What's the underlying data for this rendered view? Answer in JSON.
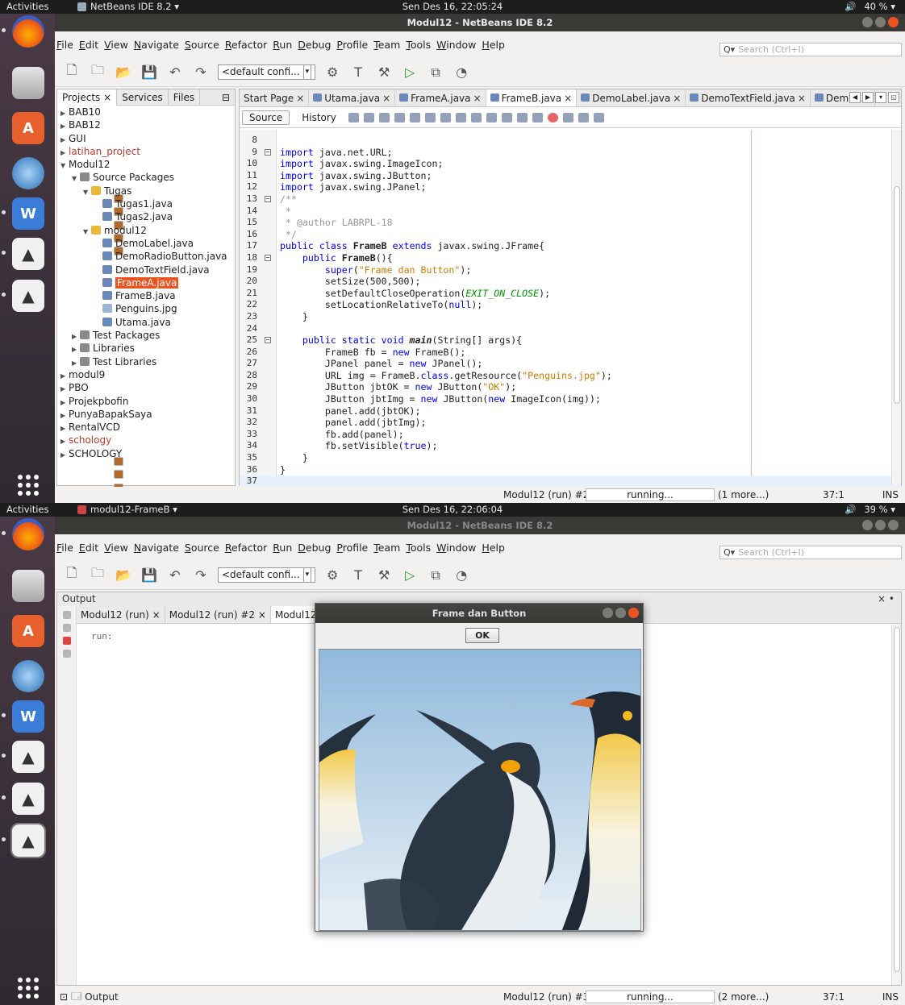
{
  "screen1": {
    "topbar": {
      "activities": "Activities",
      "app": "NetBeans IDE 8.2 ▾",
      "clock": "Sen Des 16, 22:05:24",
      "volume": "🔊",
      "battery": "40 % ▾"
    },
    "window_title": "Modul12 - NetBeans IDE 8.2",
    "menu": [
      "File",
      "Edit",
      "View",
      "Navigate",
      "Source",
      "Refactor",
      "Run",
      "Debug",
      "Profile",
      "Team",
      "Tools",
      "Window",
      "Help"
    ],
    "search_placeholder": "Search (Ctrl+I)",
    "config": "<default confi...",
    "project_tabs": [
      "Projects",
      "Services",
      "Files"
    ],
    "tree": [
      {
        "label": "BAB10",
        "level": 0,
        "type": "proj",
        "tw": "▶"
      },
      {
        "label": "BAB12",
        "level": 0,
        "type": "proj",
        "tw": "▶"
      },
      {
        "label": "GUI",
        "level": 0,
        "type": "proj",
        "tw": "▶"
      },
      {
        "label": "latihan_project",
        "level": 0,
        "type": "proj",
        "tw": "▶",
        "red": true
      },
      {
        "label": "Modul12",
        "level": 0,
        "type": "proj",
        "tw": "▼"
      },
      {
        "label": "Source Packages",
        "level": 1,
        "type": "lib",
        "tw": "▼"
      },
      {
        "label": "Tugas",
        "level": 2,
        "type": "pkg",
        "tw": "▼"
      },
      {
        "label": "Tugas1.java",
        "level": 3,
        "type": "java",
        "tw": ""
      },
      {
        "label": "Tugas2.java",
        "level": 3,
        "type": "java",
        "tw": ""
      },
      {
        "label": "modul12",
        "level": 2,
        "type": "pkg",
        "tw": "▼"
      },
      {
        "label": "DemoLabel.java",
        "level": 3,
        "type": "java",
        "tw": ""
      },
      {
        "label": "DemoRadioButton.java",
        "level": 3,
        "type": "java",
        "tw": ""
      },
      {
        "label": "DemoTextField.java",
        "level": 3,
        "type": "java",
        "tw": ""
      },
      {
        "label": "FrameA.java",
        "level": 3,
        "type": "java",
        "tw": "",
        "sel": true
      },
      {
        "label": "FrameB.java",
        "level": 3,
        "type": "java",
        "tw": ""
      },
      {
        "label": "Penguins.jpg",
        "level": 3,
        "type": "img",
        "tw": ""
      },
      {
        "label": "Utama.java",
        "level": 3,
        "type": "java",
        "tw": ""
      },
      {
        "label": "Test Packages",
        "level": 1,
        "type": "lib",
        "tw": "▶"
      },
      {
        "label": "Libraries",
        "level": 1,
        "type": "lib",
        "tw": "▶"
      },
      {
        "label": "Test Libraries",
        "level": 1,
        "type": "lib",
        "tw": "▶"
      },
      {
        "label": "modul9",
        "level": 0,
        "type": "proj",
        "tw": "▶"
      },
      {
        "label": "PBO",
        "level": 0,
        "type": "proj",
        "tw": "▶"
      },
      {
        "label": "Projekpbofin",
        "level": 0,
        "type": "proj",
        "tw": "▶"
      },
      {
        "label": "PunyaBapakSaya",
        "level": 0,
        "type": "proj",
        "tw": "▶"
      },
      {
        "label": "RentalVCD",
        "level": 0,
        "type": "proj",
        "tw": "▶"
      },
      {
        "label": "schology",
        "level": 0,
        "type": "proj",
        "tw": "▶",
        "red": true
      },
      {
        "label": "SCHOLOGY",
        "level": 0,
        "type": "proj",
        "tw": "▶"
      }
    ],
    "editor_tabs": [
      "Start Page",
      "Utama.java",
      "FrameA.java",
      "FrameB.java",
      "DemoLabel.java",
      "DemoTextField.java",
      "DemoR..."
    ],
    "source_label": "Source",
    "history_label": "History",
    "code": [
      {
        "n": "8",
        "h": ""
      },
      {
        "n": "9",
        "f": "−",
        "h": "<span class='kw'>import</span> java.net.URL;"
      },
      {
        "n": "10",
        "h": "<span class='kw'>import</span> javax.swing.ImageIcon;"
      },
      {
        "n": "11",
        "h": "<span class='kw'>import</span> javax.swing.JButton;"
      },
      {
        "n": "12",
        "h": "<span class='kw'>import</span> javax.swing.JPanel;"
      },
      {
        "n": "13",
        "f": "−",
        "h": "<span class='cmt'>/**</span>"
      },
      {
        "n": "14",
        "h": "<span class='cmt'> *</span>"
      },
      {
        "n": "15",
        "h": "<span class='cmt'> * @author LABRPL-18</span>"
      },
      {
        "n": "16",
        "h": "<span class='cmt'> */</span>"
      },
      {
        "n": "17",
        "h": "<span class='kw'>public class</span> <span class='b'>FrameB</span> <span class='kw'>extends</span> javax.swing.JFrame{"
      },
      {
        "n": "18",
        "f": "−",
        "h": "    <span class='kw'>public</span> <span class='b'>FrameB</span>(){"
      },
      {
        "n": "19",
        "h": "        <span class='kw'>super</span>(<span class='str'>\"Frame dan Button\"</span>);"
      },
      {
        "n": "20",
        "h": "        setSize(500,500);"
      },
      {
        "n": "21",
        "h": "        setDefaultCloseOperation(<span class='cn'>EXIT_ON_CLOSE</span>);"
      },
      {
        "n": "22",
        "h": "        setLocationRelativeTo(<span class='kw'>null</span>);"
      },
      {
        "n": "23",
        "h": "    }"
      },
      {
        "n": "24",
        "h": ""
      },
      {
        "n": "25",
        "f": "−",
        "h": "    <span class='kw'>public static void</span> <span class='b it'>main</span>(String[] args){"
      },
      {
        "n": "26",
        "h": "        FrameB fb = <span class='kw'>new</span> FrameB();"
      },
      {
        "n": "27",
        "h": "        JPanel panel = <span class='kw'>new</span> JPanel();"
      },
      {
        "n": "28",
        "h": "        URL img = FrameB.<span class='kw'>class</span>.getResource(<span class='str'>\"Penguins.jpg\"</span>);"
      },
      {
        "n": "29",
        "h": "        JButton jbtOK = <span class='kw'>new</span> JButton(<span class='str'>\"OK\"</span>);"
      },
      {
        "n": "30",
        "h": "        JButton jbtImg = <span class='kw'>new</span> JButton(<span class='kw'>new</span> ImageIcon(img));"
      },
      {
        "n": "31",
        "h": "        panel.add(jbtOK);"
      },
      {
        "n": "32",
        "h": "        panel.add(jbtImg);"
      },
      {
        "n": "33",
        "h": "        fb.add(panel);"
      },
      {
        "n": "34",
        "h": "        fb.setVisible(<span class='kw'>true</span>);"
      },
      {
        "n": "35",
        "h": "    }"
      },
      {
        "n": "36",
        "h": "}"
      },
      {
        "n": "37",
        "h": "",
        "cur": true
      }
    ],
    "status": {
      "run": "Modul12 (run) #2",
      "progress": "running...",
      "more": "(1 more...)",
      "pos": "37:1",
      "mode": "INS"
    }
  },
  "screen2": {
    "topbar": {
      "activities": "Activities",
      "app": "modul12-FrameB ▾",
      "clock": "Sen Des 16, 22:06:04",
      "volume": "🔊",
      "battery": "39 % ▾"
    },
    "window_title": "Modul12 - NetBeans IDE 8.2",
    "menu": [
      "File",
      "Edit",
      "View",
      "Navigate",
      "Source",
      "Refactor",
      "Run",
      "Debug",
      "Profile",
      "Team",
      "Tools",
      "Window",
      "Help"
    ],
    "search_placeholder": "Search (Ctrl+I)",
    "config": "<default confi...",
    "output_title": "Output",
    "output_tabs": [
      "Modul12 (run)",
      "Modul12 (run) #2",
      "Modul12"
    ],
    "output_text": "run:",
    "jframe_title": "Frame dan Button",
    "ok_label": "OK",
    "bottom_tab": "Output",
    "status": {
      "run": "Modul12 (run) #3",
      "progress": "running...",
      "more": "(2 more...)",
      "pos": "37:1",
      "mode": "INS"
    }
  }
}
